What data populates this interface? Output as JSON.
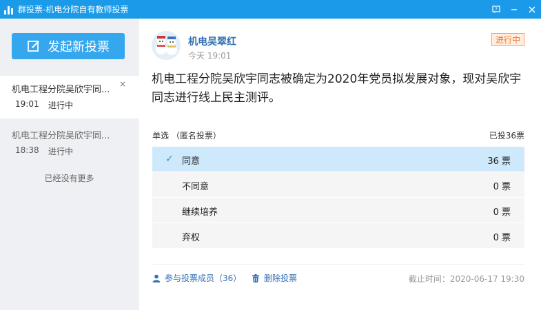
{
  "window": {
    "title": "群投票-机电分院自有教师投票",
    "icons": [
      "bar-chart-icon",
      "help-icon",
      "minimize-icon",
      "close-icon"
    ]
  },
  "sidebar": {
    "new_vote_label": "发起新投票",
    "items": [
      {
        "title": "机电工程分院吴欣宇同...",
        "time": "19:01",
        "status": "进行中",
        "active": true,
        "close": "×"
      },
      {
        "title": "机电工程分院吴欣宇同...",
        "time": "18:38",
        "status": "进行中",
        "active": false
      }
    ],
    "no_more": "已经没有更多"
  },
  "vote": {
    "author": "机电吴翠红",
    "post_time": "今天 19:01",
    "status": "进行中",
    "question": "机电工程分院吴欣宇同志被确定为2020年党员拟发展对象，现对吴欣宇同志进行线上民主测评。",
    "type_label": "单选 （匿名投票）",
    "total_label": "已投36票",
    "options": [
      {
        "label": "同意",
        "count": "36 票",
        "selected": true
      },
      {
        "label": "不同意",
        "count": "0 票",
        "selected": false
      },
      {
        "label": "继续培养",
        "count": "0 票",
        "selected": false
      },
      {
        "label": "弃权",
        "count": "0 票",
        "selected": false
      }
    ],
    "members_link": "参与投票成员（36）",
    "delete_link": "删除投票",
    "deadline": "截止时间：2020-06-17 19:30"
  },
  "colors": {
    "titlebar": "#1a9ae8",
    "primary_button": "#35a7ef",
    "link": "#2f6fb3",
    "selected_option": "#cde9fb",
    "status_orange": "#f07a2a"
  }
}
